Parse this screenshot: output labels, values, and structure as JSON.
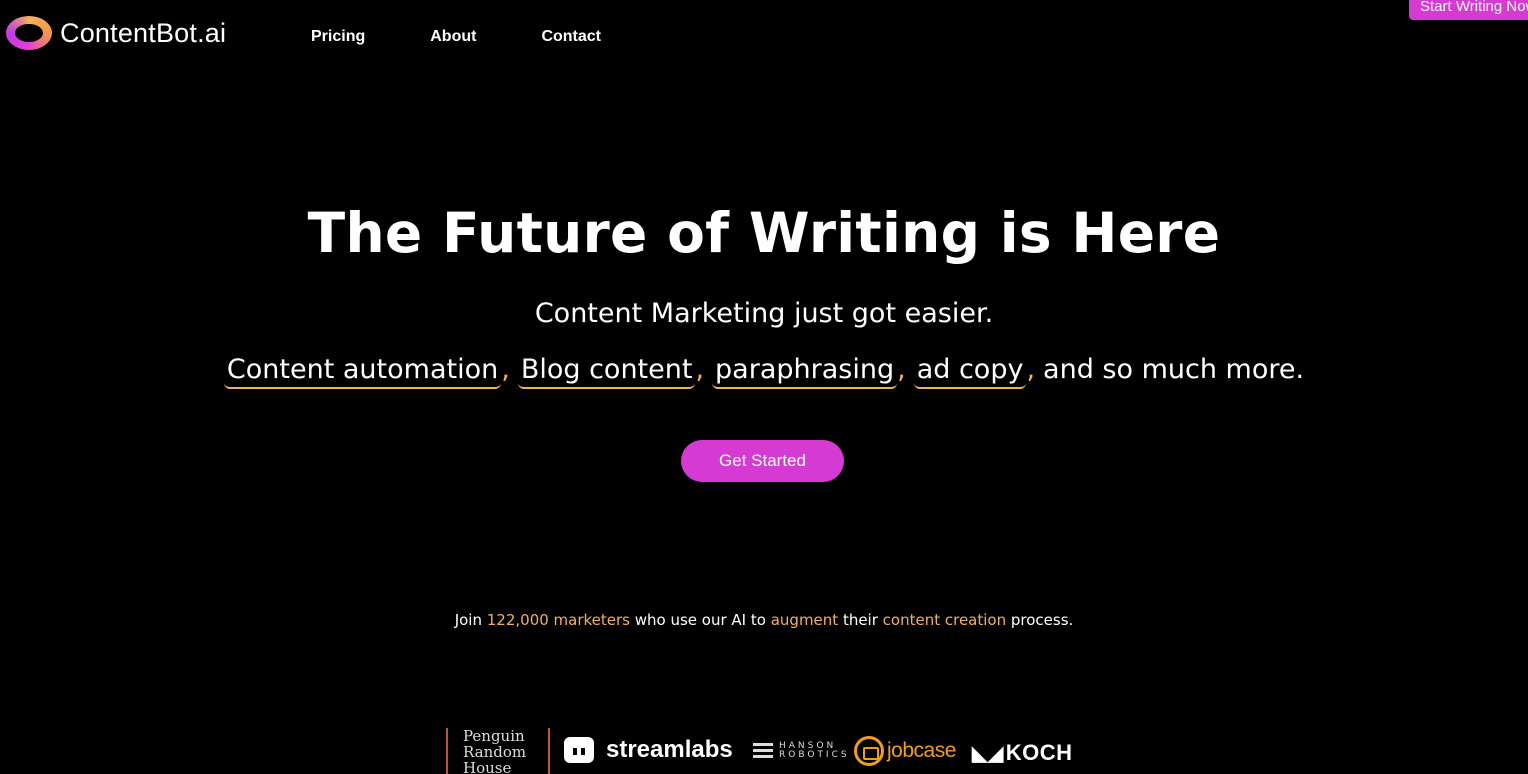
{
  "header": {
    "brand": "ContentBot.ai",
    "nav": [
      "Pricing",
      "About",
      "Contact"
    ],
    "cta": "Start Writing Now"
  },
  "hero": {
    "title": "The Future of Writing is Here",
    "subtitle": "Content Marketing just got easier.",
    "features": [
      "Content automation",
      "Blog content",
      "paraphrasing",
      "ad copy"
    ],
    "features_suffix": "and so much more.",
    "button": "Get Started"
  },
  "proof": {
    "parts": [
      "Join ",
      "122,000 marketers",
      " who use our AI to ",
      "augment",
      " their ",
      "content creation",
      " process."
    ]
  },
  "logos": {
    "penguin": [
      "Penguin",
      "Random",
      "House"
    ],
    "streamlabs": "streamlabs",
    "hanson": [
      "HANSON",
      "ROBOTICS"
    ],
    "jobcase": "jobcase",
    "koch": "KOCH"
  },
  "colors": {
    "accent": "#d53bd3",
    "highlight": "#f2b05c",
    "background": "#000000"
  }
}
